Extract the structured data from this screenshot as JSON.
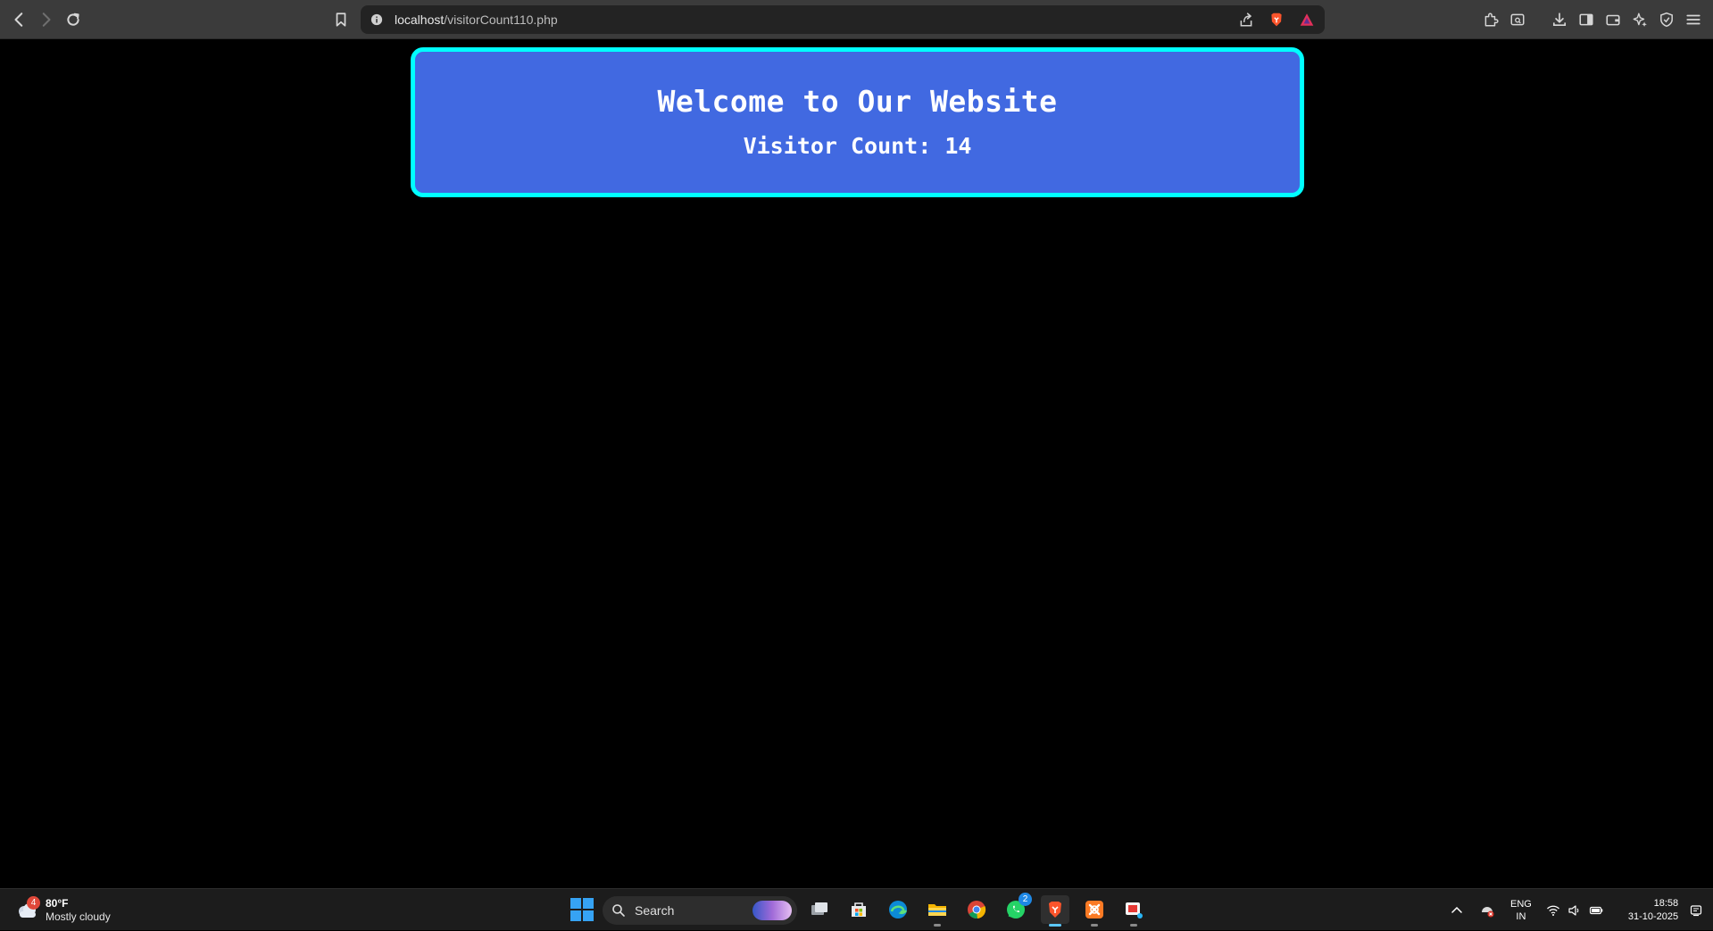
{
  "browser": {
    "url_host": "localhost",
    "url_path": "/visitorCount110.php"
  },
  "page": {
    "heading": "Welcome to Our Website",
    "visitor_count_text": "Visitor Count: 14",
    "colors": {
      "background": "#000000",
      "card": "#4169e1",
      "card_border": "#00ffff",
      "text": "#ffffff"
    }
  },
  "taskbar": {
    "weather": {
      "badge": "4",
      "temperature": "80°F",
      "condition": "Mostly cloudy"
    },
    "search_label": "Search",
    "whatsapp_badge": "2",
    "language": {
      "line1": "ENG",
      "line2": "IN"
    },
    "clock": {
      "time": "18:58",
      "date": "31-10-2025"
    }
  }
}
